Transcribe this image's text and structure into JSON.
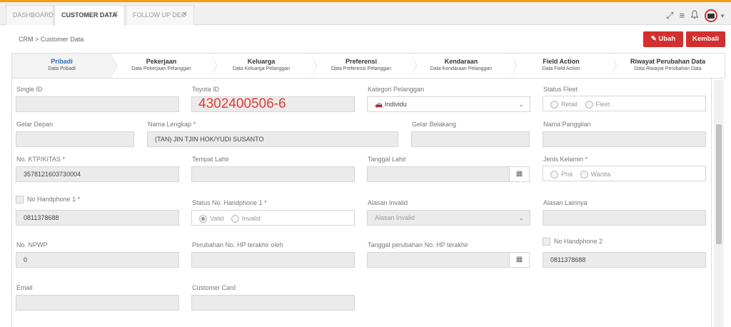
{
  "tabs": [
    {
      "label": "DASHBOARD"
    },
    {
      "label": "CUSTOMER DATA",
      "close": "✕"
    },
    {
      "label": "FOLLOW UP DEC",
      "close": "✕"
    }
  ],
  "breadcrumb": "CRM > Customer Data",
  "buttons": {
    "edit": "Ubah",
    "back": "Kembali"
  },
  "steps": [
    {
      "title": "Pribadi",
      "sub": "Data Pribadi"
    },
    {
      "title": "Pekerjaan",
      "sub": "Data Pekerjaan Pelanggan"
    },
    {
      "title": "Keluarga",
      "sub": "Data Keluarga Pelanggan"
    },
    {
      "title": "Preferensi",
      "sub": "Data Preferensi Pelanggan"
    },
    {
      "title": "Kendaraan",
      "sub": "Data Kendaraan Pelanggan"
    },
    {
      "title": "Field Action",
      "sub": "Data Field Action"
    },
    {
      "title": "Riwayat Perubahan Data",
      "sub": "Data Riwayat Perubahan Data"
    }
  ],
  "form": {
    "single_id": {
      "label": "Single ID",
      "value": ""
    },
    "toyota_id": {
      "label": "Toyota ID",
      "value": "4302400506-6"
    },
    "kategori": {
      "label": "Kategori Pelanggan",
      "value": "Individu"
    },
    "status_fleet": {
      "label": "Status Fleet",
      "opt1": "Retail",
      "opt2": "Fleet"
    },
    "gelar_depan": {
      "label": "Gelar Depan",
      "value": ""
    },
    "nama_lengkap": {
      "label": "Nama Lengkap *",
      "value": "(TAN) JIN TJIN HOK/YUDI SUSANTO"
    },
    "gelar_belakang": {
      "label": "Gelar Belakang",
      "value": ""
    },
    "nama_panggilan": {
      "label": "Nama Panggilan",
      "value": ""
    },
    "ktp": {
      "label": "No. KTP/KITAS *",
      "value": "3578121603730004"
    },
    "tempat_lahir": {
      "label": "Tempat Lahir",
      "value": ""
    },
    "tanggal_lahir": {
      "label": "Tanggal Lahir",
      "value": ""
    },
    "jenis_kelamin": {
      "label": "Jenis Kelamin *",
      "opt1": "Pria",
      "opt2": "Wanita"
    },
    "no_hp1": {
      "label": "No Handphone 1 *",
      "value": "0811378688"
    },
    "status_hp1": {
      "label": "Status No. Handphone 1 *",
      "opt1": "Valid",
      "opt2": "Invalid"
    },
    "alasan_invalid": {
      "label": "Alasan Invalid",
      "value": "Alasan Invalid"
    },
    "alasan_lainnya": {
      "label": "Alasan Lainnya",
      "value": ""
    },
    "npwp": {
      "label": "No. NPWP",
      "value": "0"
    },
    "perubahan_hp_oleh": {
      "label": "Perubahan No. HP terakhir oleh",
      "value": ""
    },
    "tanggal_perubahan_hp": {
      "label": "Tanggal perubahan No. HP terakhir",
      "value": ""
    },
    "no_hp2": {
      "label": "No Handphone 2",
      "value": "0811378688"
    },
    "email": {
      "label": "Email",
      "value": ""
    },
    "customer_card": {
      "label": "Customer Card",
      "value": ""
    }
  }
}
